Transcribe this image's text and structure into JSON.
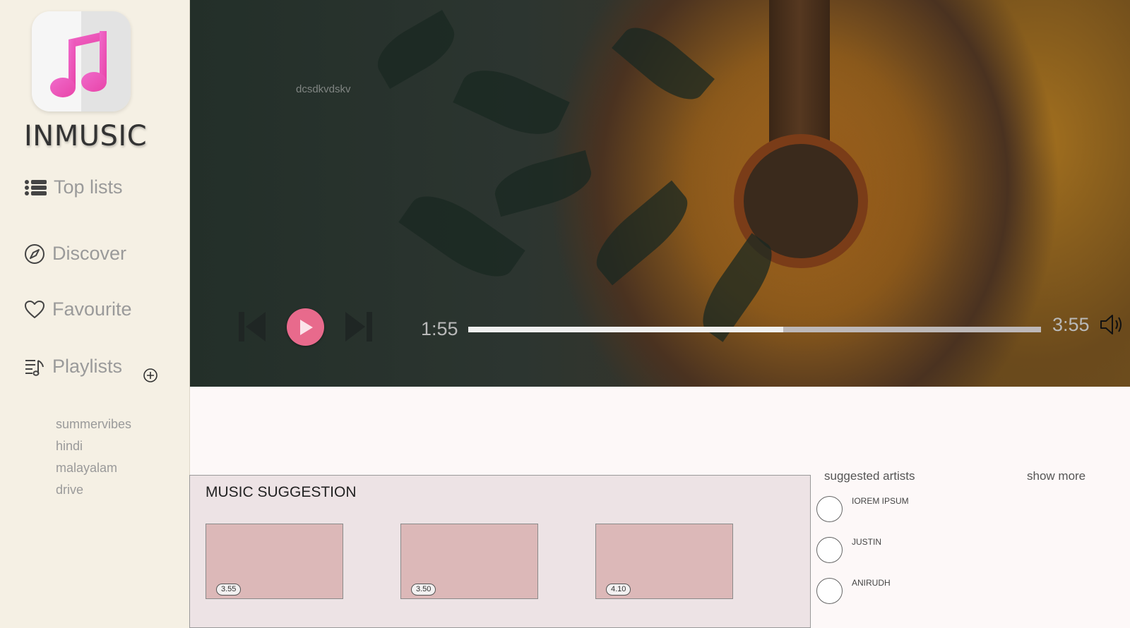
{
  "app": {
    "name": "INMUSIC",
    "logo_icon": "music-note-icon"
  },
  "sidebar": {
    "nav": [
      {
        "label": "Top lists",
        "icon": "list-icon"
      },
      {
        "label": "Discover",
        "icon": "compass-icon"
      },
      {
        "label": "Favourite",
        "icon": "heart-icon"
      },
      {
        "label": "Playlists",
        "icon": "playlist-icon"
      }
    ],
    "add_playlist_icon": "plus-circle-icon",
    "playlists": [
      "summervibes",
      "hindi",
      "malayalam",
      "drive"
    ]
  },
  "player": {
    "watermark": "dcsdkvdskv",
    "current_time": "1:55",
    "total_time": "3:55",
    "progress_percent": 55,
    "accent_color": "#e86a8c",
    "volume_icon": "speaker-icon"
  },
  "suggestion": {
    "title": "MUSIC SUGGESTION",
    "cards": [
      {
        "duration": "3.55"
      },
      {
        "duration": "3.50"
      },
      {
        "duration": "4.10"
      }
    ]
  },
  "artists": {
    "title": "suggested artists",
    "show_more": "show more",
    "items": [
      {
        "name": "IOREM IPSUM"
      },
      {
        "name": "JUSTIN"
      },
      {
        "name": "ANIRUDH"
      }
    ]
  }
}
